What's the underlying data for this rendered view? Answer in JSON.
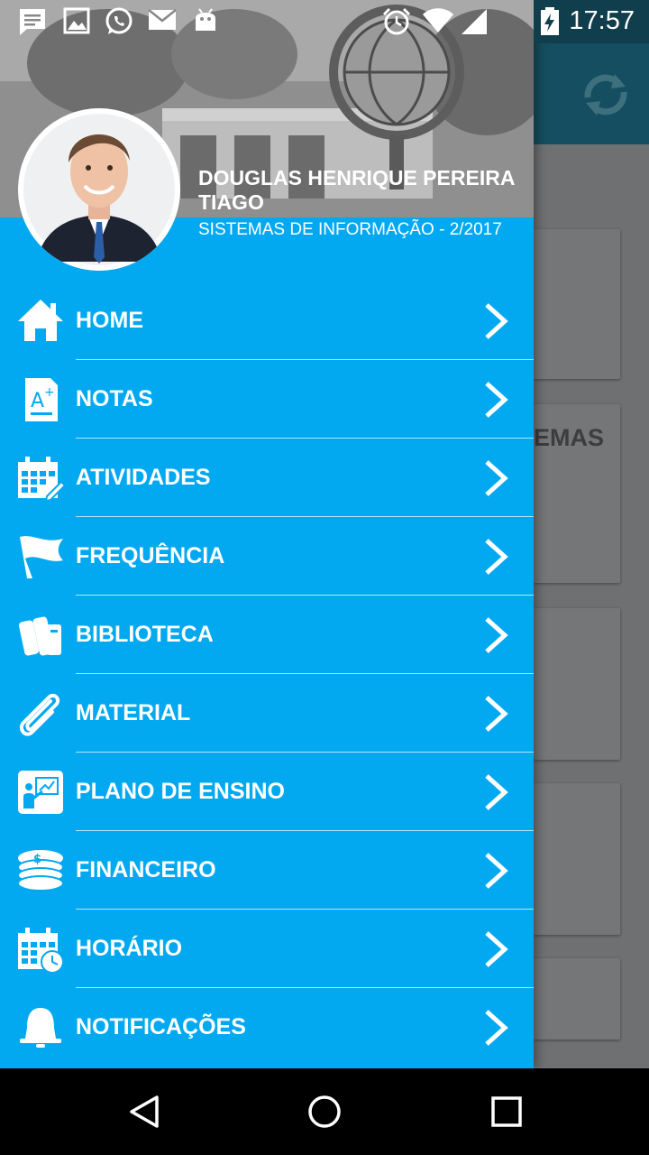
{
  "status_bar": {
    "time": "17:57",
    "icons": [
      "message-icon",
      "image-icon",
      "whatsapp-icon",
      "email-icon",
      "android-icon",
      "alarm-icon",
      "wifi-icon",
      "signal-icon",
      "battery-charging-icon"
    ]
  },
  "background_app": {
    "card_text": "EMAS",
    "refresh_icon": "refresh-icon"
  },
  "drawer": {
    "user_name": "DOUGLAS HENRIQUE PEREIRA TIAGO",
    "course": "SISTEMAS DE INFORMAÇÃO - 2/2017",
    "menu_items": [
      {
        "label": "HOME",
        "icon": "home-icon"
      },
      {
        "label": "NOTAS",
        "icon": "grades-icon"
      },
      {
        "label": "ATIVIDADES",
        "icon": "calendar-edit-icon"
      },
      {
        "label": "FREQUÊNCIA",
        "icon": "flag-icon"
      },
      {
        "label": "BIBLIOTECA",
        "icon": "books-icon"
      },
      {
        "label": "MATERIAL",
        "icon": "paperclip-icon"
      },
      {
        "label": "PLANO DE ENSINO",
        "icon": "teacher-board-icon"
      },
      {
        "label": "FINANCEIRO",
        "icon": "coins-icon"
      },
      {
        "label": "HORÁRIO",
        "icon": "calendar-clock-icon"
      },
      {
        "label": "NOTIFICAÇÕES",
        "icon": "bell-icon"
      }
    ]
  },
  "nav_bar": {
    "buttons": [
      "back-icon",
      "home-circle-icon",
      "recents-icon"
    ]
  },
  "colors": {
    "drawer_bg": "#03a9f0",
    "toolbar": "#154e60",
    "text": "#ffffff"
  }
}
